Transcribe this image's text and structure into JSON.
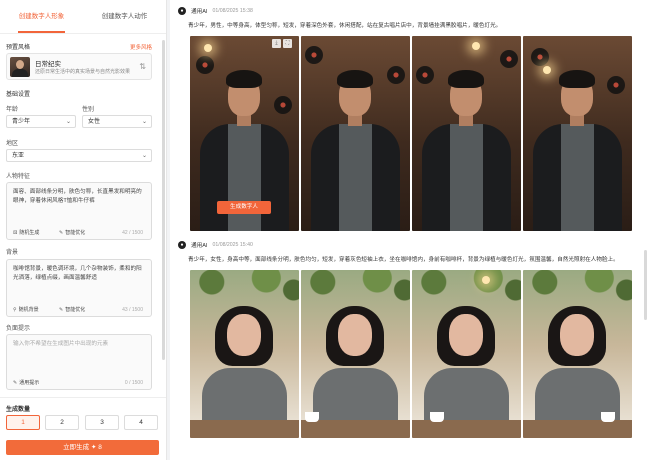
{
  "tabs": [
    {
      "label": "创建数字人形象",
      "active": true
    },
    {
      "label": "创建数字人动作",
      "active": false
    }
  ],
  "style": {
    "section_label": "预置风格",
    "link": "更多风格",
    "selected_title": "日常纪实",
    "selected_desc": "还原日常生活中的真实场景与自然光影效果"
  },
  "basic": {
    "section_label": "基础设置",
    "age_label": "年龄",
    "age_value": "青少年",
    "gender_label": "性别",
    "gender_value": "女性",
    "region_label": "地区",
    "region_value": "东亚"
  },
  "features": {
    "label": "人物特征",
    "text": "面容、面部线条分明，肤色匀称，长直黑发和明亮的眼神，穿着休闲风格T恤和牛仔裤",
    "chip1": "随机生成",
    "chip2": "智能优化",
    "count": "42 / 1500"
  },
  "background": {
    "label": "背景",
    "text": "咖啡馆背景，暖色调环境，几个杂物装饰，柔和的阳光洒落，绿植点缀，画面温馨舒适",
    "chip1": "随机背景",
    "chip2": "智能优化",
    "count": "43 / 1500"
  },
  "negative": {
    "label": "负面提示",
    "placeholder": "输入你不希望在生成图片中出现的元素",
    "chip1": "通用提示",
    "count": "0 / 1500"
  },
  "quantity": {
    "label": "生成数量",
    "options": [
      "1",
      "2",
      "3",
      "4"
    ],
    "selected": 0
  },
  "generate_button": "立即生成 ✦ 8",
  "posts": [
    {
      "avatar": "●",
      "name": "通用AI",
      "date": "01/08/2025 15:38",
      "desc": "青少年，男性，中等身高，体型匀称，短发，穿着深色外套，休闲搭配，站在复古唱片店中，背景墙挂满黑胶唱片，暖色灯光。",
      "overlay_button": "生成数字人"
    },
    {
      "avatar": "●",
      "name": "通用AI",
      "date": "01/08/2025 15:40",
      "desc": "青少年，女性，身高中等，面部线条分明，肤色均匀，短发，穿着灰色短袖上衣，坐在咖啡馆内，身前有咖啡杯，背景为绿植与暖色灯光，氛围温馨，自然光照射在人物脸上。"
    }
  ],
  "icons": {
    "style_swap": "swap-icon",
    "chip_random": "dice-icon",
    "chip_optimize": "wand-icon"
  }
}
